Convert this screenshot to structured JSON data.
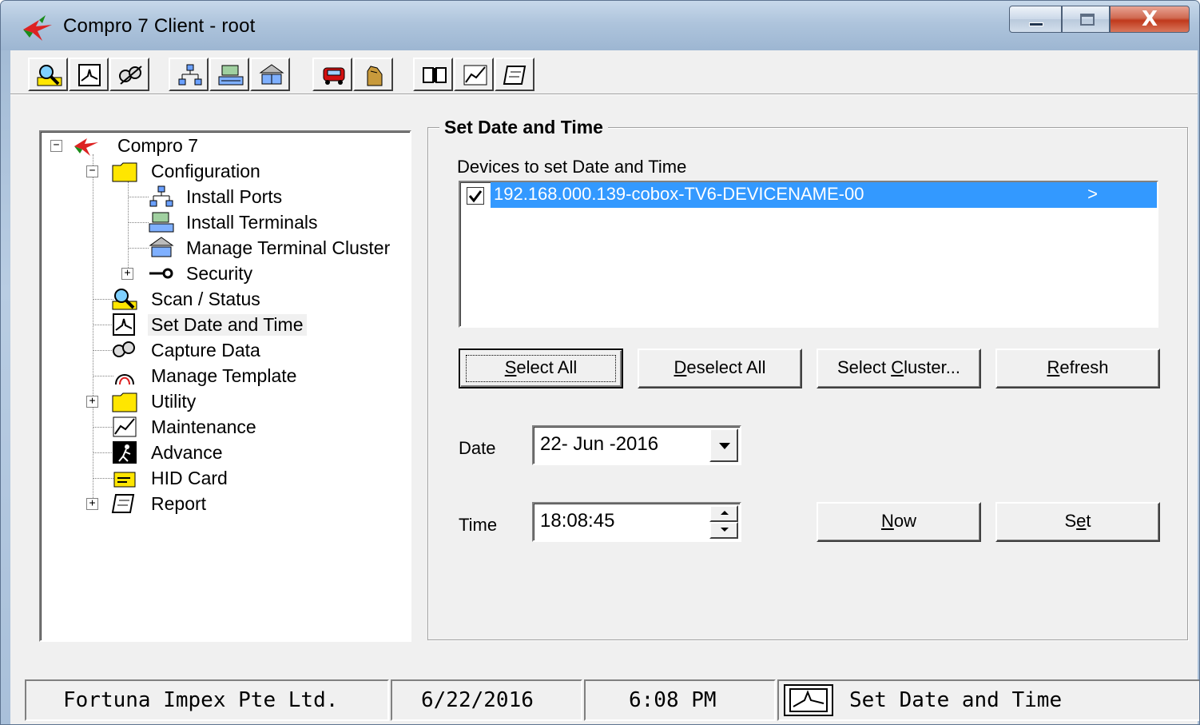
{
  "window": {
    "title": "Compro 7 Client - root",
    "close_glyph": "X"
  },
  "toolbar": {
    "buttons": [
      {
        "name": "scan-status",
        "icon": "magnifier-icon"
      },
      {
        "name": "set-date-time",
        "icon": "clock-graph-icon"
      },
      {
        "name": "capture-data",
        "icon": "capture-icon"
      },
      {
        "name": "install-ports",
        "icon": "network-icon"
      },
      {
        "name": "install-terminals",
        "icon": "terminals-icon"
      },
      {
        "name": "manage-cluster",
        "icon": "cluster-icon"
      },
      {
        "name": "security",
        "icon": "car-icon"
      },
      {
        "name": "utility",
        "icon": "hand-icon"
      },
      {
        "name": "advance",
        "icon": "book-icon"
      },
      {
        "name": "maintenance",
        "icon": "chart-icon"
      },
      {
        "name": "report",
        "icon": "report-icon"
      }
    ]
  },
  "tree": {
    "root": "Compro 7",
    "items": [
      {
        "label": "Configuration"
      },
      {
        "label": "Install Ports"
      },
      {
        "label": "Install Terminals"
      },
      {
        "label": "Manage Terminal Cluster"
      },
      {
        "label": "Security"
      },
      {
        "label": "Scan / Status"
      },
      {
        "label": "Set Date and Time"
      },
      {
        "label": "Capture Data"
      },
      {
        "label": "Manage Template"
      },
      {
        "label": "Utility"
      },
      {
        "label": "Maintenance"
      },
      {
        "label": "Advance"
      },
      {
        "label": "HID Card"
      },
      {
        "label": "Report"
      }
    ],
    "expander_minus": "−",
    "expander_plus": "+"
  },
  "panel": {
    "group_title": "Set Date and Time",
    "devices_label": "Devices to set Date and Time",
    "devices": [
      {
        "name": "192.168.000.139-cobox-TV6-DEVICENAME-00",
        "checked": true,
        "arrow": ">"
      }
    ],
    "buttons": {
      "select_all": {
        "pre": "",
        "key": "S",
        "post": "elect All"
      },
      "deselect_all": {
        "pre": "",
        "key": "D",
        "post": "eselect All"
      },
      "select_cluster": {
        "pre": "Select ",
        "key": "C",
        "post": "luster..."
      },
      "refresh": {
        "pre": "",
        "key": "R",
        "post": "efresh"
      },
      "now": {
        "pre": "",
        "key": "N",
        "post": "ow"
      },
      "set": {
        "pre": "S",
        "key": "e",
        "post": "t"
      }
    },
    "date_label": "Date",
    "date_value": "22- Jun -2016",
    "time_label": "Time",
    "time_value": "18:08:45"
  },
  "status": {
    "company": "Fortuna Impex Pte Ltd.",
    "date": "6/22/2016",
    "time": "6:08 PM",
    "current_view": "Set Date and Time"
  },
  "colors": {
    "selection": "#3399ff",
    "face": "#f0f0f0",
    "folder": "#ffe600"
  }
}
